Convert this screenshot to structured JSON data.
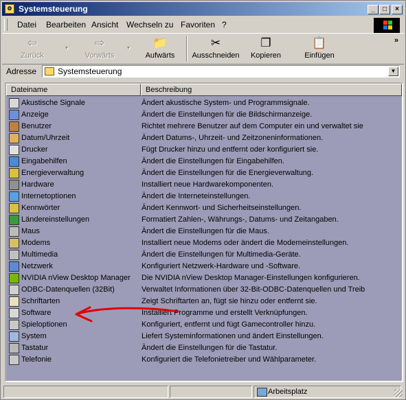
{
  "window": {
    "title": "Systemsteuerung"
  },
  "menubar": {
    "items": [
      {
        "label": "Datei"
      },
      {
        "label": "Bearbeiten"
      },
      {
        "label": "Ansicht"
      },
      {
        "label": "Wechseln zu"
      },
      {
        "label": "Favoriten"
      },
      {
        "label": "?"
      }
    ]
  },
  "toolbar": {
    "back": "Zurück",
    "forward": "Vorwärts",
    "up": "Aufwärts",
    "cut": "Ausschneiden",
    "copy": "Kopieren",
    "paste": "Einfügen",
    "more": "»"
  },
  "address": {
    "label": "Adresse",
    "value": "Systemsteuerung"
  },
  "list": {
    "columns": [
      "Dateiname",
      "Beschreibung"
    ],
    "rows": [
      {
        "name": "Akustische Signale",
        "desc": "Ändert akustische System- und Programmsignale."
      },
      {
        "name": "Anzeige",
        "desc": "Ändert die Einstellungen für die Bildschirmanzeige."
      },
      {
        "name": "Benutzer",
        "desc": "Richtet mehrere Benutzer auf dem Computer ein und verwaltet sie"
      },
      {
        "name": "Datum/Uhrzeit",
        "desc": "Ändert Datums-, Uhrzeit- und Zeitzoneninformationen."
      },
      {
        "name": "Drucker",
        "desc": "Fügt Drucker hinzu und entfernt oder konfiguriert sie."
      },
      {
        "name": "Eingabehilfen",
        "desc": "Ändert die Einstellungen für Eingabehilfen."
      },
      {
        "name": "Energieverwaltung",
        "desc": "Ändert die Einstellungen für die Energieverwaltung."
      },
      {
        "name": "Hardware",
        "desc": "Installiert neue Hardwarekomponenten."
      },
      {
        "name": "Internetoptionen",
        "desc": "Ändert die Interneteinstellungen."
      },
      {
        "name": "Kennwörter",
        "desc": "Ändert Kennwort- und Sicherheitseinstellungen."
      },
      {
        "name": "Ländereinstellungen",
        "desc": "Formatiert Zahlen-, Währungs-, Datums- und Zeitangaben."
      },
      {
        "name": "Maus",
        "desc": "Ändert die Einstellungen für die Maus."
      },
      {
        "name": "Modems",
        "desc": "Installiert neue Modems oder ändert die Modemeinstellungen."
      },
      {
        "name": "Multimedia",
        "desc": "Ändert die Einstellungen für Multimedia-Geräte."
      },
      {
        "name": "Netzwerk",
        "desc": "Konfiguriert Netzwerk-Hardware und -Software."
      },
      {
        "name": "NVIDIA nView Desktop Manager",
        "desc": "Die NVIDIA nView Desktop Manager-Einstellungen konfigurieren."
      },
      {
        "name": "ODBC-Datenquellen (32Bit)",
        "desc": "Verwaltet Informationen über 32-Bit-ODBC-Datenquellen und Treib"
      },
      {
        "name": "Schriftarten",
        "desc": "Zeigt Schriftarten an, fügt sie hinzu oder entfernt sie."
      },
      {
        "name": "Software",
        "desc": "Installiert Programme und erstellt Verknüpfungen."
      },
      {
        "name": "Spieloptionen",
        "desc": "Konfiguriert, entfernt und fügt Gamecontroller hinzu."
      },
      {
        "name": "System",
        "desc": "Liefert Systeminformationen und ändert Einstellungen."
      },
      {
        "name": "Tastatur",
        "desc": "Ändert die Einstellungen für die Tastatur."
      },
      {
        "name": "Telefonie",
        "desc": "Konfiguriert die Telefonietreiber und Wählparameter."
      }
    ]
  },
  "status": {
    "zone": "Arbeitsplatz"
  },
  "colors": {
    "list_background": "#9c9cb8",
    "annotation_arrow": "#e00000"
  }
}
